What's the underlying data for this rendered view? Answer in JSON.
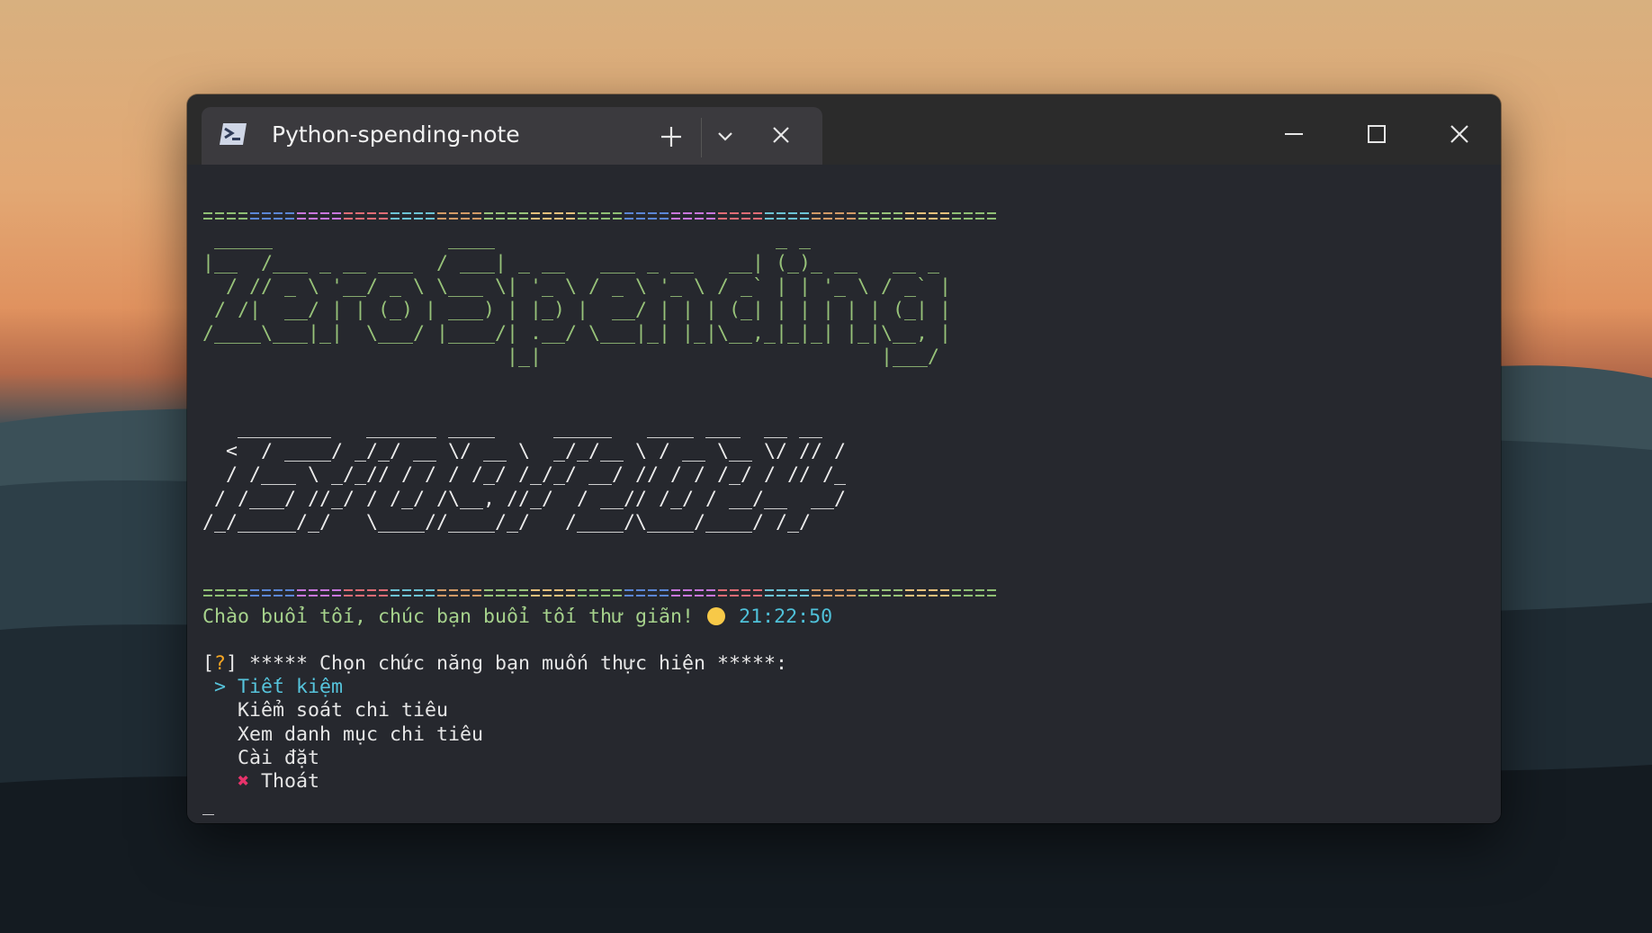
{
  "window": {
    "tab_title": "Python-spending-note",
    "tab_icon": "powershell-icon"
  },
  "terminal": {
    "ascii_zero_spending": [
      " _____               ____                        _ _             ",
      "|__  /___ _ __ ___  / ___| _ __   ___ _ __   __| (_)_ __   __ _ ",
      "  / // _ \\ '__/ _ \\ \\___ \\| '_ \\ / _ \\ '_ \\ / _` | | '_ \\ / _` |",
      " / /|  __/ | | (_) | ___) | |_) |  __/ | | | (_| | | | | | (_| |",
      "/____\\___|_|  \\___/ |____/| .__/ \\___|_| |_|\\__,_|_|_| |_|\\__, |",
      "                          |_|                             |___/ "
    ],
    "ascii_2023": [
      "   ________   ______ ____     _____   ____ ___  __ __",
      "  <  / ____/ _/_/ __ \\/ __ \\  _/_/__ \\ / __ \\__ \\/ // /",
      "  / /___ \\ _/_// / / / /_/ /_/_/ __/ // / / /_/ / // /_",
      " / /___/ //_/ / /_/ /\\__, //_/  / __// /_/ / __/__  __/",
      "/_/_____/_/   \\____//____/_/   /____/\\____/____/ /_/"
    ],
    "greeting": "Chào buổi tối, chúc bạn buổi tối thư giãn!",
    "time": "21:22:50",
    "prompt_open": "[",
    "prompt_mark": "?",
    "prompt_text": "] ***** Chọn chức năng bạn muốn thực hiện *****:",
    "menu": {
      "pointer": ">",
      "items": [
        "Tiết kiệm",
        "Kiểm soát chi tiêu",
        "Xem danh mục chi tiêu",
        "Cài đặt",
        "Thoát"
      ]
    },
    "cursor": "_",
    "rule_colors": [
      "#8fbf74",
      "#5b86d6",
      "#c876dd",
      "#e06c75",
      "#6cc3d5",
      "#d19a66",
      "#98c379",
      "#e5c07b"
    ]
  }
}
